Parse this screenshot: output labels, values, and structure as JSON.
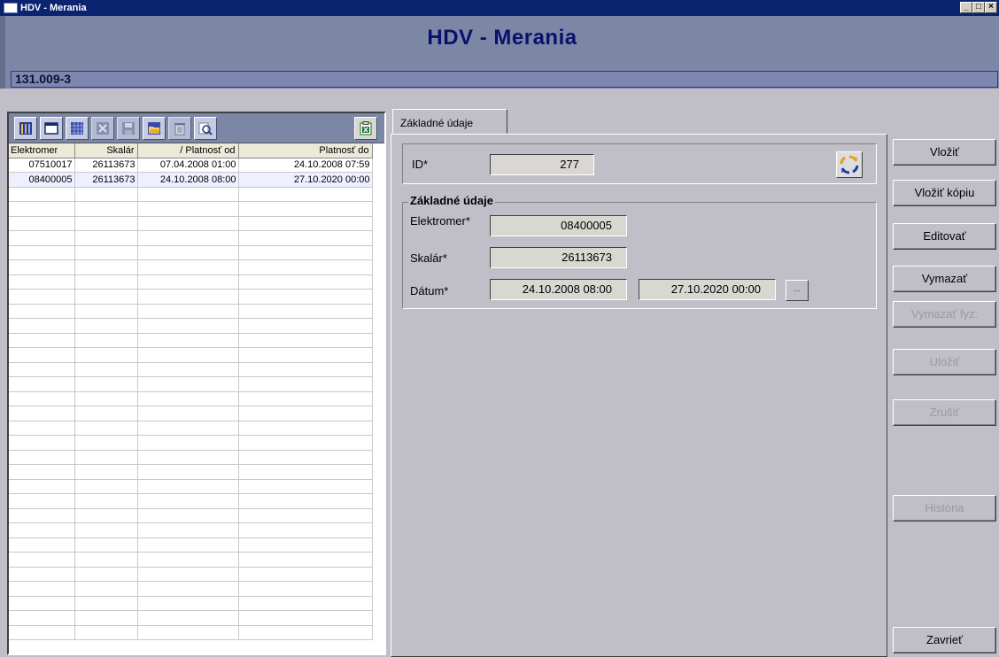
{
  "window": {
    "title": "HDV - Merania",
    "controls": [
      "_",
      "□",
      "×"
    ]
  },
  "header": {
    "title": "HDV - Merania",
    "record": "131.009-3"
  },
  "toolbar": {
    "buttons": [
      "grid-columns-icon",
      "window-icon",
      "grid-icon",
      "delete-icon",
      "save-icon",
      "open-folder-icon",
      "trash-icon",
      "search-icon"
    ],
    "export": "excel-export-icon"
  },
  "table": {
    "columns": [
      "Elektromer",
      "Skalár",
      "/ Platnosť od",
      "Platnosť do"
    ],
    "rows": [
      [
        "07510017",
        "26113673",
        "07.04.2008 01:00",
        "24.10.2008 07:59"
      ],
      [
        "08400005",
        "26113673",
        "24.10.2008 08:00",
        "27.10.2020 00:00"
      ]
    ]
  },
  "tab": {
    "label": "Základné údaje"
  },
  "form": {
    "id_label": "ID*",
    "id_value": "277",
    "group_label": "Základné údaje",
    "elektromer_label": "Elektromer*",
    "elektromer_value": "08400005",
    "skalar_label": "Skalár*",
    "skalar_value": "26113673",
    "datum_label": "Dátum*",
    "datum_from": "24.10.2008 08:00",
    "datum_to": "27.10.2020 00:00",
    "picker_label": "..."
  },
  "actions": {
    "vlozit": "Vložiť",
    "vlozit_kopiu": "Vložiť kópiu",
    "editovat": "Editovať",
    "vymazat": "Vymazať",
    "vymazat_fyz": "Vymazať fyz.",
    "ulozit": "Uložiť",
    "zrusit": "Zrušiť",
    "historia": "História",
    "zavriet": "Zavrieť"
  },
  "colors": {
    "titlebar": "#0a2470",
    "header": "#7c87a6",
    "header_text": "#08126a",
    "panel": "#c0bfc8"
  }
}
